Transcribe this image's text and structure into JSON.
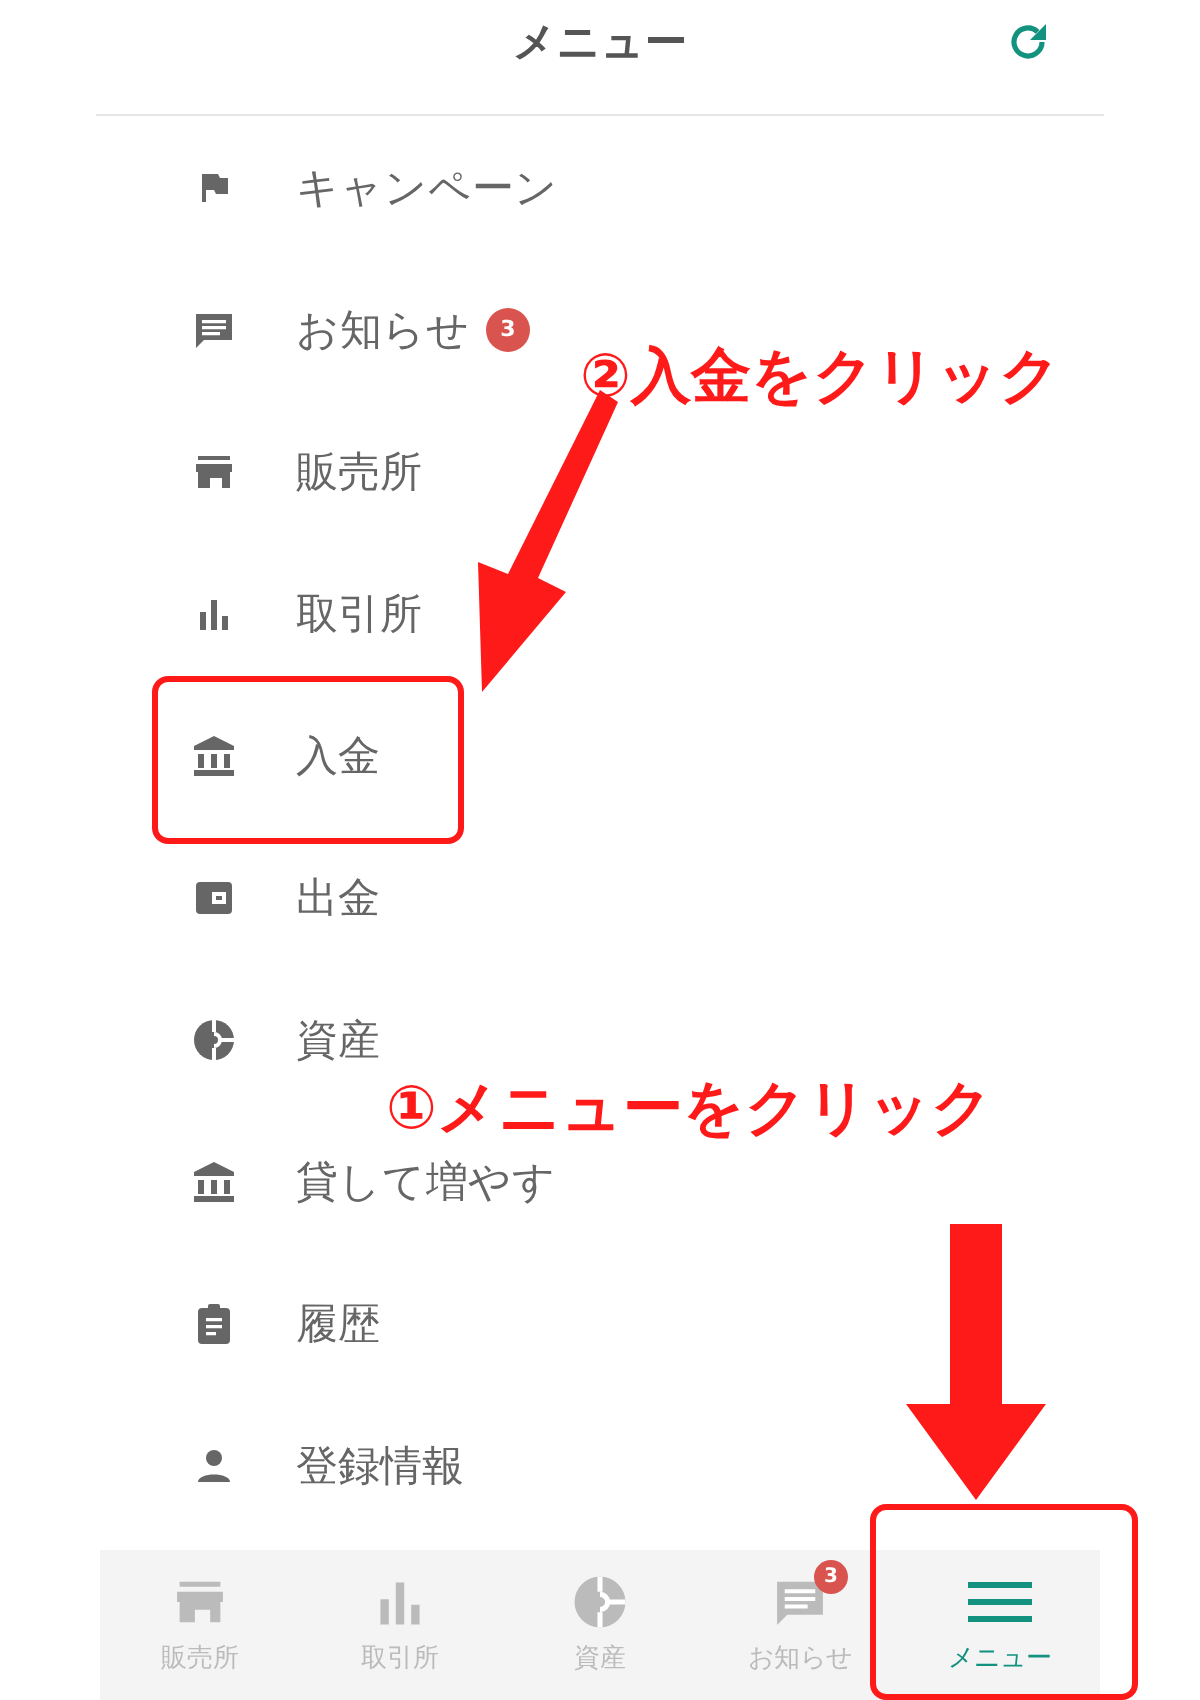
{
  "header": {
    "title": "メニュー"
  },
  "menu": {
    "items": [
      {
        "label": "キャンペーン"
      },
      {
        "label": "お知らせ",
        "badge": "3"
      },
      {
        "label": "販売所"
      },
      {
        "label": "取引所"
      },
      {
        "label": "入金"
      },
      {
        "label": "出金"
      },
      {
        "label": "資産"
      },
      {
        "label": "貸して増やす"
      },
      {
        "label": "履歴"
      },
      {
        "label": "登録情報"
      }
    ]
  },
  "tab_bar": {
    "tabs": [
      {
        "label": "販売所",
        "selected": false
      },
      {
        "label": "取引所",
        "selected": false
      },
      {
        "label": "資産",
        "selected": false
      },
      {
        "label": "お知らせ",
        "selected": false,
        "badge": "3"
      },
      {
        "label": "メニュー",
        "selected": true
      }
    ]
  },
  "annotations": [
    {
      "kind": "callout",
      "text": "②入金をクリック"
    },
    {
      "kind": "callout",
      "text": "①メニューをクリック"
    }
  ]
}
